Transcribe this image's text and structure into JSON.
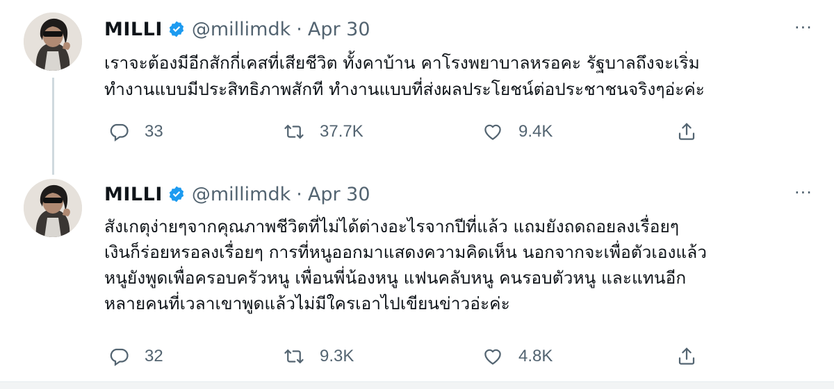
{
  "tweets": [
    {
      "name": "MILLI",
      "handle": "@millimdk",
      "separator": "·",
      "date": "Apr 30",
      "more": "···",
      "lines": [
        "เราจะต้องมีอีกสักกี่เคสที่เสียชีวิต ทั้งคาบ้าน คาโรงพยาบาลหรอคะ รัฐบาลถึงจะเริ่ม",
        "ทำงานแบบมีประสิทธิภาพสักที ทำงานแบบที่ส่งผลประโยชน์ต่อประชาชนจริงๆอ่ะค่ะ"
      ],
      "replies": "33",
      "retweets": "37.7K",
      "likes": "9.4K"
    },
    {
      "name": "MILLI",
      "handle": "@millimdk",
      "separator": "·",
      "date": "Apr 30",
      "more": "···",
      "lines": [
        "สังเกตุง่ายๆจากคุณภาพชีวิตที่ไม่ได้ต่างอะไรจากปีที่แล้ว แถมยังถดถอยลงเรื่อยๆ",
        "เงินก็ร่อยหรอลงเรื่อยๆ การที่หนูออกมาแสดงความคิดเห็น นอกจากจะเพื่อตัวเองแล้ว",
        "หนูยังพูดเพื่อครอบครัวหนู เพื่อนพี่น้องหนู แฟนคลับหนู คนรอบตัวหนู และแทนอีก",
        "หลายคนที่เวลาเขาพูดแล้วไม่มีใครเอาไปเขียนข่าวอ่ะค่ะ"
      ],
      "replies": "32",
      "retweets": "9.3K",
      "likes": "4.8K"
    }
  ],
  "icons": {
    "reply": "reply-icon",
    "retweet": "retweet-icon",
    "like": "heart-icon",
    "share": "share-icon",
    "verified": "verified-badge-icon",
    "more": "more-options-icon"
  },
  "colors": {
    "text": "#0f1419",
    "muted": "#536471",
    "verified": "#1d9bf0",
    "thread_line": "#cfd9de"
  }
}
